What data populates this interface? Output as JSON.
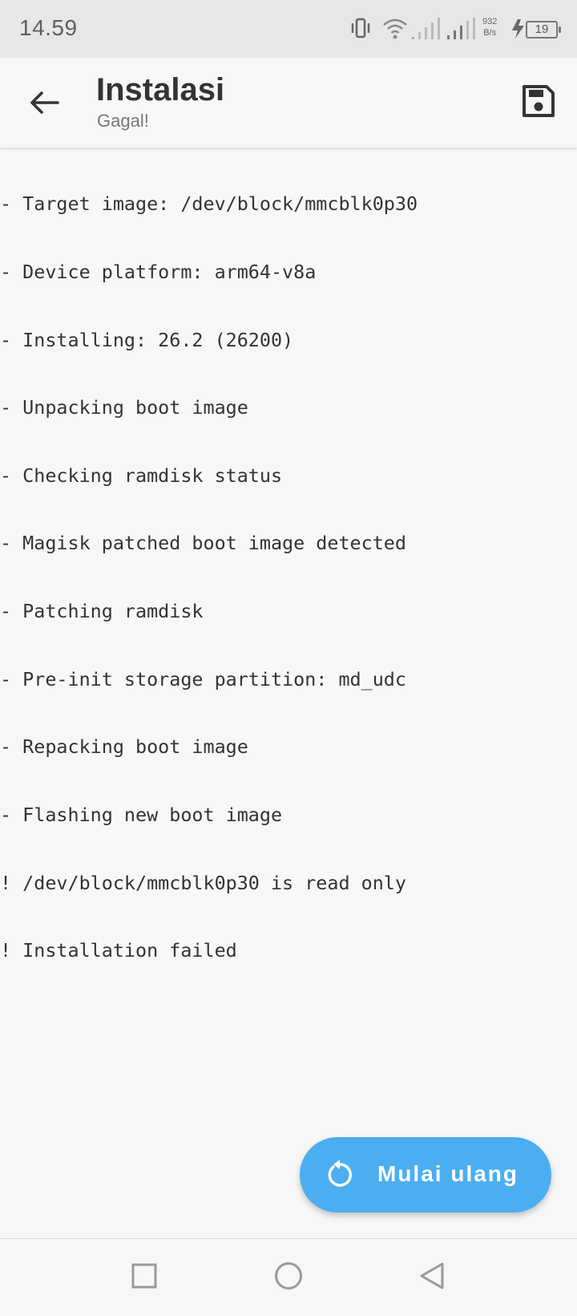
{
  "status_bar": {
    "time": "14.59",
    "net_speed_value": "932",
    "net_speed_unit": "B/s",
    "battery_level": "19"
  },
  "app_bar": {
    "back_icon": "arrow-left-icon",
    "title": "Instalasi",
    "subtitle": "Gagal!",
    "save_icon": "save-icon"
  },
  "log": {
    "lines": [
      "- Target image: /dev/block/mmcblk0p30",
      "- Device platform: arm64-v8a",
      "- Installing: 26.2 (26200)",
      "- Unpacking boot image",
      "- Checking ramdisk status",
      "- Magisk patched boot image detected",
      "- Patching ramdisk",
      "- Pre-init storage partition: md_udc",
      "- Repacking boot image",
      "- Flashing new boot image",
      "! /dev/block/mmcblk0p30 is read only",
      "! Installation failed"
    ]
  },
  "fab": {
    "icon": "restart-icon",
    "label": "Mulai ulang",
    "color": "#4aaef1"
  },
  "nav_bar": {
    "recent_icon": "square-icon",
    "home_icon": "circle-icon",
    "back_icon": "triangle-back-icon"
  }
}
